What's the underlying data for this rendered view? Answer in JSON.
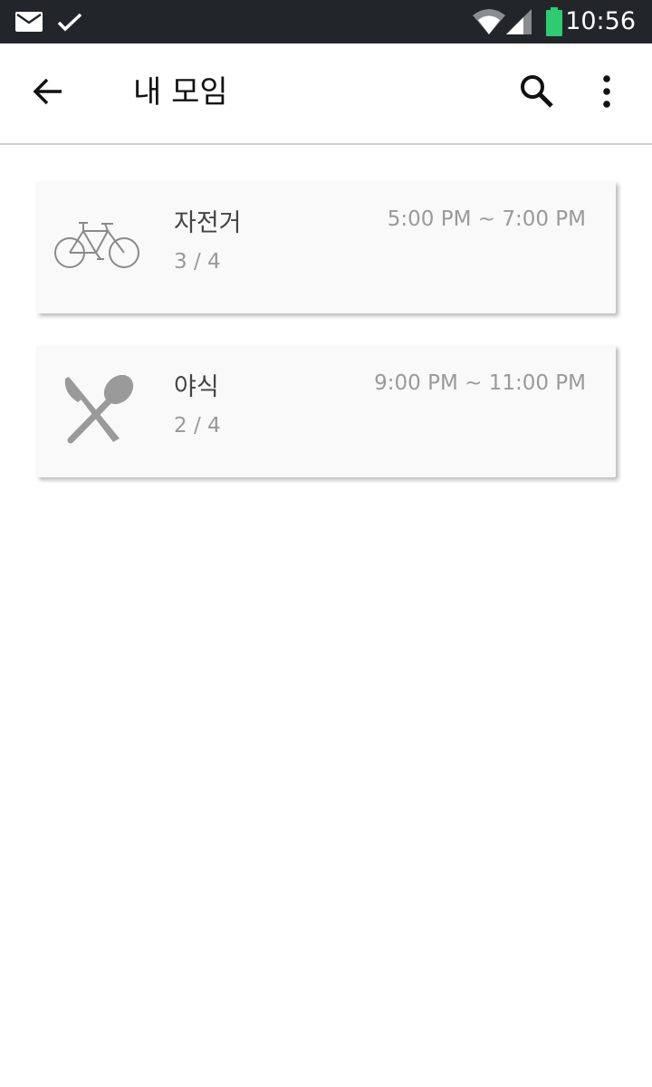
{
  "status_bar": {
    "time": "10:56",
    "icons": [
      "mail-icon",
      "check-icon",
      "wifi-icon",
      "cell-signal-icon",
      "battery-icon"
    ],
    "battery_color": "#2ecc71"
  },
  "app_bar": {
    "title": "내 모임",
    "icons": [
      "back-arrow-icon",
      "search-icon",
      "more-vert-icon"
    ]
  },
  "meetups": [
    {
      "icon": "bicycle-icon",
      "name": "자전거",
      "count": "3 / 4",
      "time": "5:00 PM ~ 7:00 PM"
    },
    {
      "icon": "fork-spoon-icon",
      "name": "야식",
      "count": "2 / 4",
      "time": "9:00 PM ~ 11:00 PM"
    }
  ],
  "colors": {
    "status_bar_bg": "#22262a",
    "card_bg": "#f9f9f9",
    "icon_gray": "#9a9a9a"
  }
}
